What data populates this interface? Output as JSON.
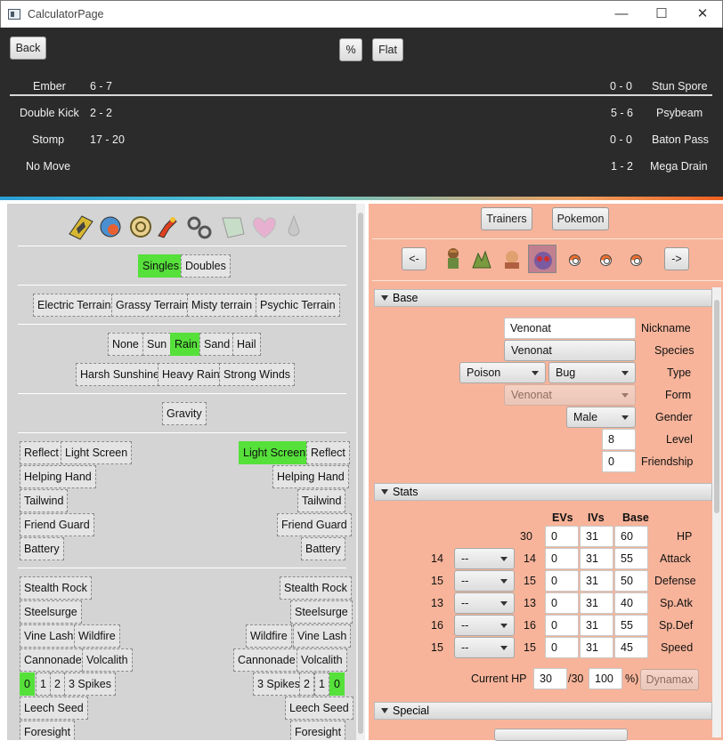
{
  "window": {
    "title": "CalculatorPage",
    "minimize": "—",
    "maximize": "☐",
    "close": "✕"
  },
  "toolbar": {
    "back": "Back",
    "percent": "%",
    "flat": "Flat"
  },
  "moves_left": [
    {
      "name": "Ember",
      "dmg": "6 - 7"
    },
    {
      "name": "Double Kick",
      "dmg": "2 - 2"
    },
    {
      "name": "Stomp",
      "dmg": "17 - 20"
    },
    {
      "name": "No Move",
      "dmg": ""
    }
  ],
  "moves_right": [
    {
      "name": "Stun Spore",
      "dmg": "0 - 0"
    },
    {
      "name": "Psybeam",
      "dmg": "5 - 6"
    },
    {
      "name": "Baton Pass",
      "dmg": "0 - 0"
    },
    {
      "name": "Mega Drain",
      "dmg": "1 - 2"
    }
  ],
  "field": {
    "mode": [
      "Singles",
      "Doubles"
    ],
    "mode_selected": "Singles",
    "terrains": [
      "Electric Terrain",
      "Grassy Terrain",
      "Misty terrain",
      "Psychic Terrain"
    ],
    "weather1": [
      "None",
      "Sun",
      "Rain",
      "Sand",
      "Hail"
    ],
    "weather_selected": "Rain",
    "weather2": [
      "Harsh Sunshine",
      "Heavy Rain",
      "Strong Winds"
    ],
    "gravity": "Gravity",
    "left_side": {
      "reflect": "Reflect",
      "light_screen": "Light Screen",
      "helping_hand": "Helping Hand",
      "tailwind": "Tailwind",
      "friend_guard": "Friend Guard",
      "battery": "Battery"
    },
    "right_side": {
      "light_screen": "Light Screen",
      "reflect": "Reflect",
      "helping_hand": "Helping Hand",
      "tailwind": "Tailwind",
      "friend_guard": "Friend Guard",
      "battery": "Battery"
    },
    "hazards_left": {
      "stealth_rock": "Stealth Rock",
      "steelsurge": "Steelsurge",
      "vine_lash": "Vine Lash",
      "wildfire": "Wildfire",
      "cannonade": "Cannonade",
      "volcalith": "Volcalith",
      "spikes": [
        "0",
        "1",
        "2",
        "3 Spikes"
      ],
      "leech_seed": "Leech Seed",
      "foresight": "Foresight"
    },
    "hazards_right": {
      "stealth_rock": "Stealth Rock",
      "steelsurge": "Steelsurge",
      "wildfire": "Wildfire",
      "vine_lash": "Vine Lash",
      "cannonade": "Cannonade",
      "volcalith": "Volcalith",
      "spikes": [
        "3 Spikes",
        "2",
        "1",
        "0"
      ],
      "leech_seed": "Leech Seed",
      "foresight": "Foresight"
    }
  },
  "pokemon_panel": {
    "trainers": "Trainers",
    "pokemon": "Pokemon",
    "prev": "<-",
    "next": "->",
    "base_header": "Base",
    "nickname_value": "Venonat",
    "nickname_label": "Nickname",
    "species_value": "Venonat",
    "species_label": "Species",
    "type1": "Poison",
    "type2": "Bug",
    "type_label": "Type",
    "form_value": "Venonat",
    "form_label": "Form",
    "gender_value": "Male",
    "gender_label": "Gender",
    "level_value": "8",
    "level_label": "Level",
    "friendship_value": "0",
    "friendship_label": "Friendship",
    "stats_header": "Stats",
    "col_evs": "EVs",
    "col_ivs": "IVs",
    "col_base": "Base",
    "stats": [
      {
        "name": "HP",
        "pre": "",
        "nature": "",
        "val": "30",
        "ev": "0",
        "iv": "31",
        "base": "60"
      },
      {
        "name": "Attack",
        "pre": "14",
        "nature": "--",
        "val": "14",
        "ev": "0",
        "iv": "31",
        "base": "55"
      },
      {
        "name": "Defense",
        "pre": "15",
        "nature": "--",
        "val": "15",
        "ev": "0",
        "iv": "31",
        "base": "50"
      },
      {
        "name": "Sp.Atk",
        "pre": "13",
        "nature": "--",
        "val": "13",
        "ev": "0",
        "iv": "31",
        "base": "40"
      },
      {
        "name": "Sp.Def",
        "pre": "16",
        "nature": "--",
        "val": "16",
        "ev": "0",
        "iv": "31",
        "base": "55"
      },
      {
        "name": "Speed",
        "pre": "15",
        "nature": "--",
        "val": "15",
        "ev": "0",
        "iv": "31",
        "base": "45"
      }
    ],
    "current_hp_label": "Current HP",
    "current_hp": "30",
    "max_hp": "/30",
    "hp_percent": "100",
    "percent_suffix": "%)",
    "dynamax": "Dynamax",
    "special_header": "Special"
  },
  "colors": {
    "selected": "#55e03a",
    "panel_right": "#f7b49a",
    "panel_left": "#d4d4d4",
    "topbar": "#2b2b2b"
  }
}
